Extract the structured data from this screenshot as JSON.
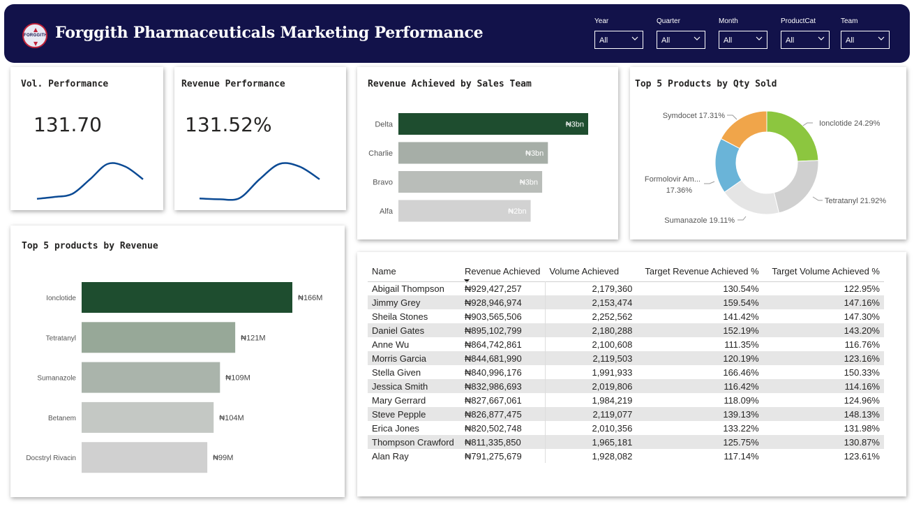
{
  "header": {
    "title": "Forggith Pharmaceuticals Marketing Performance",
    "logo_text": "FORGGITH",
    "slicers": [
      {
        "label": "Year",
        "value": "All"
      },
      {
        "label": "Quarter",
        "value": "All"
      },
      {
        "label": "Month",
        "value": "All"
      },
      {
        "label": "ProductCat",
        "value": "All"
      },
      {
        "label": "Team",
        "value": "All"
      }
    ]
  },
  "kpis": {
    "volume": {
      "title": "Vol. Performance",
      "value": "131.70"
    },
    "revenue": {
      "title": "Revenue Performance",
      "value": "131.52%"
    }
  },
  "colors": {
    "header_bg": "#12124a",
    "dark_green": "#1e4d2f",
    "sparkline": "#0b4a94",
    "donut": [
      "#8cc63f",
      "#d0d0d0",
      "#e5e5e5",
      "#6ab4d8",
      "#f0a54a"
    ]
  },
  "chart_data": [
    {
      "type": "bar",
      "orientation": "horizontal",
      "title": "Revenue Achieved by Sales Team",
      "categories": [
        "Delta",
        "Charlie",
        "Bravo",
        "Alfa"
      ],
      "values": [
        3.3,
        2.6,
        2.5,
        2.3
      ],
      "data_labels": [
        "₦3bn",
        "₦3bn",
        "₦3bn",
        "₦2bn"
      ],
      "bar_colors": [
        "#1e4d2f",
        "#a6aea7",
        "#b9bdb9",
        "#d2d2d2"
      ]
    },
    {
      "type": "pie",
      "style": "donut",
      "title": "Top 5 Products by Qty Sold",
      "labels": [
        "Ionclotide",
        "Tetratanyl",
        "Sumanazole",
        "Formolovir Am...",
        "Symdocet"
      ],
      "values": [
        24.29,
        21.92,
        19.11,
        17.36,
        17.31
      ],
      "data_labels": [
        "Ionclotide 24.29%",
        "Tetratanyl 21.92%",
        "Sumanazole 19.11%",
        "Formolovir Am...",
        "17.36%",
        "Symdocet 17.31%"
      ]
    },
    {
      "type": "bar",
      "orientation": "horizontal",
      "title": "Top 5 products by Revenue",
      "categories": [
        "Ionclotide",
        "Tetratanyl",
        "Sumanazole",
        "Betanem",
        "Docstryl Rivacin"
      ],
      "values": [
        166,
        121,
        109,
        104,
        99
      ],
      "data_labels": [
        "₦166M",
        "₦121M",
        "₦109M",
        "₦104M",
        "₦99M"
      ],
      "bar_colors": [
        "#1e4d2f",
        "#97a898",
        "#aab4ab",
        "#c4c8c4",
        "#d0d0d0"
      ]
    },
    {
      "type": "line",
      "style": "sparkline",
      "title": "Vol. Performance",
      "values": [
        0.04,
        0.09,
        0.17,
        0.55,
        0.95,
        0.88,
        0.55
      ]
    },
    {
      "type": "line",
      "style": "sparkline",
      "title": "Revenue Performance",
      "values": [
        0.05,
        0.03,
        0.06,
        0.55,
        0.95,
        0.88,
        0.55
      ]
    },
    {
      "type": "table",
      "columns": [
        "Name",
        "Revenue Achieved",
        "Volume Achieved",
        "Target Revenue Achieved %",
        "Target Volume Achieved %"
      ],
      "rows": [
        [
          "Abigail Thompson",
          "₦929,427,257",
          "2,179,360",
          "130.54%",
          "122.95%"
        ],
        [
          "Jimmy Grey",
          "₦928,946,974",
          "2,153,474",
          "159.54%",
          "147.16%"
        ],
        [
          "Sheila Stones",
          "₦903,565,506",
          "2,252,562",
          "141.42%",
          "147.30%"
        ],
        [
          "Daniel Gates",
          "₦895,102,799",
          "2,180,288",
          "152.19%",
          "143.20%"
        ],
        [
          "Anne Wu",
          "₦864,742,861",
          "2,100,608",
          "111.35%",
          "116.76%"
        ],
        [
          "Morris Garcia",
          "₦844,681,990",
          "2,119,503",
          "120.19%",
          "123.16%"
        ],
        [
          "Stella Given",
          "₦840,996,176",
          "1,991,933",
          "166.46%",
          "150.33%"
        ],
        [
          "Jessica Smith",
          "₦832,986,693",
          "2,019,806",
          "116.42%",
          "114.16%"
        ],
        [
          "Mary Gerrard",
          "₦827,667,061",
          "1,984,219",
          "118.09%",
          "124.96%"
        ],
        [
          "Steve Pepple",
          "₦826,877,475",
          "2,119,077",
          "139.13%",
          "148.13%"
        ],
        [
          "Erica Jones",
          "₦820,502,748",
          "2,010,356",
          "133.22%",
          "131.98%"
        ],
        [
          "Thompson Crawford",
          "₦811,335,850",
          "1,965,181",
          "125.75%",
          "130.87%"
        ],
        [
          "Alan Ray",
          "₦791,275,679",
          "1,928,082",
          "117.14%",
          "123.61%"
        ]
      ]
    }
  ]
}
